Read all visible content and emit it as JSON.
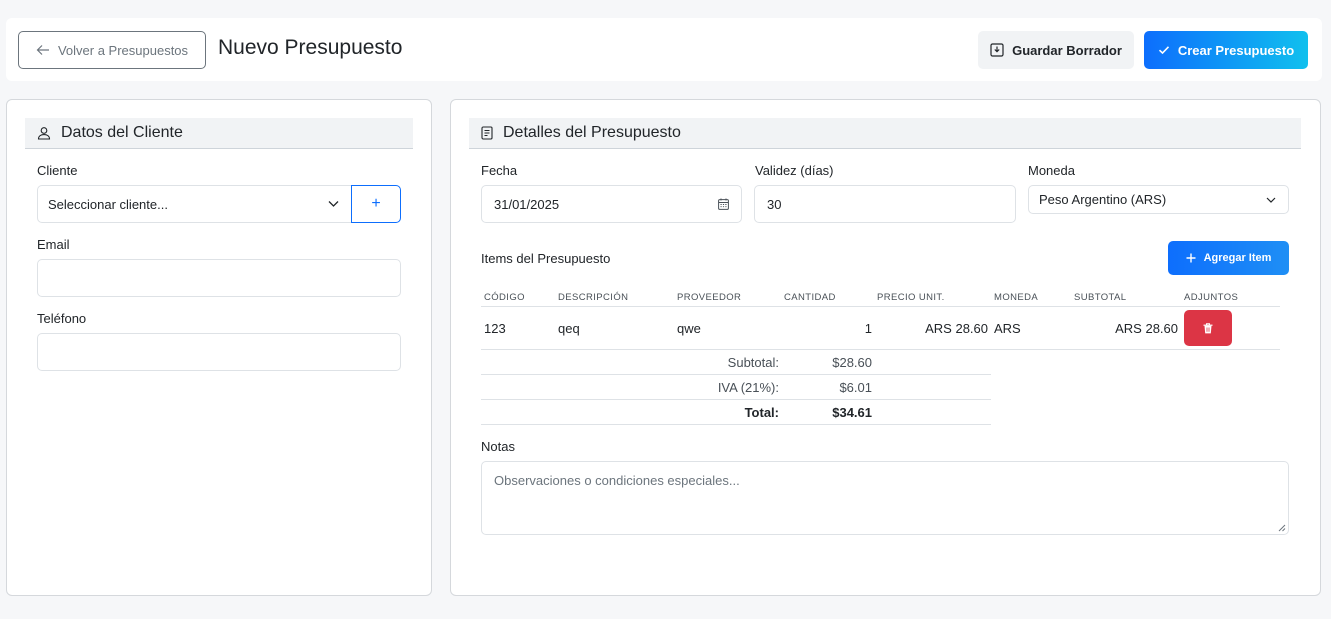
{
  "header": {
    "back_label": "Volver a Presupuestos",
    "title": "Nuevo Presupuesto",
    "draft_label": "Guardar Borrador",
    "create_label": "Crear Presupuesto"
  },
  "client": {
    "section_title": "Datos del Cliente",
    "client_label": "Cliente",
    "client_select": "Seleccionar cliente...",
    "add_button": "+",
    "email_label": "Email",
    "email_value": "",
    "phone_label": "Teléfono",
    "phone_value": ""
  },
  "details": {
    "section_title": "Detalles del Presupuesto",
    "date_label": "Fecha",
    "date_value": "31/01/2025",
    "validity_label": "Validez (días)",
    "validity_value": "30",
    "currency_label": "Moneda",
    "currency_value": "Peso Argentino (ARS)"
  },
  "items": {
    "title": "Items del Presupuesto",
    "add_label": "Agregar Item",
    "columns": [
      "CÓDIGO",
      "DESCRIPCIÓN",
      "PROVEEDOR",
      "CANTIDAD",
      "PRECIO UNIT.",
      "MONEDA",
      "SUBTOTAL",
      "ADJUNTOS"
    ],
    "rows": [
      {
        "code": "123",
        "description": "qeq",
        "supplier": "qwe",
        "quantity": "1",
        "unit_price": "ARS 28.60",
        "currency": "ARS",
        "subtotal": "ARS 28.60"
      }
    ]
  },
  "totals": {
    "subtotal_label": "Subtotal:",
    "subtotal_value": "$28.60",
    "iva_label": "IVA (21%):",
    "iva_value": "$6.01",
    "total_label": "Total:",
    "total_value": "$34.61"
  },
  "notes": {
    "label": "Notas",
    "placeholder": "Observaciones o condiciones especiales..."
  },
  "colors": {
    "primary": "#0d6efd",
    "gradient_end": "#10c0ee",
    "danger": "#dc3545"
  },
  "icons": {
    "back": "arrow-left-icon",
    "draft": "download-box-icon",
    "create": "check-icon",
    "client": "user-icon",
    "details": "document-icon",
    "calendar": "calendar-icon",
    "chevron": "chevron-down-icon",
    "add": "plus-icon",
    "delete": "trash-icon"
  }
}
